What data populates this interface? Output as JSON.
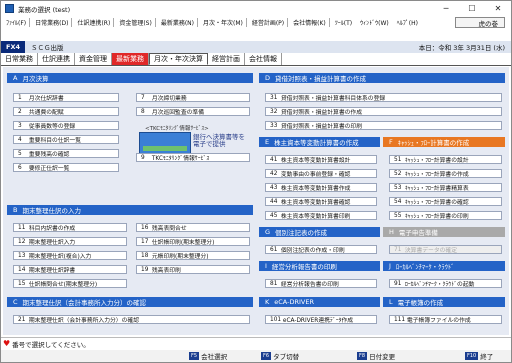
{
  "window": {
    "title": "業務の選択 (test)",
    "minimize": "─",
    "maximize": "☐",
    "close": "✕"
  },
  "menu": {
    "items": [
      "ﾌｧｲﾙ(F)",
      "日常業務(D)",
      "仕訳連携(R)",
      "資金管理(S)",
      "最新業務(N)",
      "月次・年次(M)",
      "経営計画(P)",
      "会社情報(K)",
      "ﾂｰﾙ(T)",
      "ｳｨﾝﾄﾞｳ(W)",
      "ﾍﾙﾌﾟ(H)"
    ],
    "right_label": "虎の巻"
  },
  "company": {
    "code": "FX4",
    "name": "ＳＣＧ出版",
    "date": "本日：令和 3年 3月31日 (水)"
  },
  "tabs": [
    "日常業務",
    "仕訳連携",
    "資金管理",
    "最新業務",
    "月次・年次決算",
    "経営計画",
    "会社情報"
  ],
  "sections": {
    "a": {
      "mark": "A",
      "title": "月次決算"
    },
    "b": {
      "mark": "B",
      "title": "期末整理仕訳の入力"
    },
    "c": {
      "mark": "C",
      "title": "期末整理仕訳（会計事務所入力分）の確認"
    },
    "d": {
      "mark": "D",
      "title": "貸借対照表・損益計算書の作成"
    },
    "e": {
      "mark": "E",
      "title": "株主資本等変動計算書の作成"
    },
    "f": {
      "mark": "F",
      "title": "ｷｬｯｼｭ・ﾌﾛｰ計算書の作成"
    },
    "g": {
      "mark": "G",
      "title": "個別注記表の作成"
    },
    "h": {
      "mark": "H",
      "title": "電子申告準備"
    },
    "i": {
      "mark": "I",
      "title": "経営分析報告書の印刷"
    },
    "j": {
      "mark": "J",
      "title": "ﾛｰｶﾙﾍﾞﾝﾁﾏｰｸ・ｸﾗｳﾄﾞ"
    },
    "k": {
      "mark": "K",
      "title": "eCA-DRIVER"
    },
    "l": {
      "mark": "L",
      "title": "電子帳簿の作成"
    }
  },
  "buttons": {
    "a1": {
      "num": "1",
      "label": "月次仕訳辞書"
    },
    "a2": {
      "num": "2",
      "label": "共通費の配賦"
    },
    "a3": {
      "num": "3",
      "label": "従事員数等の登録"
    },
    "a4": {
      "num": "4",
      "label": "重要科目の仕訳一覧"
    },
    "a5": {
      "num": "5",
      "label": "重要残高の確認"
    },
    "a6": {
      "num": "6",
      "label": "要修正仕訳一覧"
    },
    "a7": {
      "num": "7",
      "label": "月次締切業務"
    },
    "a8": {
      "num": "8",
      "label": "月次巡回監査の準備"
    },
    "a9": {
      "num": "9",
      "label": "TKCﾓﾆﾀﾘﾝｸﾞ情報ｻｰﾋﾞｽ"
    },
    "b11": {
      "num": "11",
      "label": "科目内訳書の作成"
    },
    "b12": {
      "num": "12",
      "label": "期末整理仕訳入力"
    },
    "b13": {
      "num": "13",
      "label": "期末整理仕訳(複合)入力"
    },
    "b14": {
      "num": "14",
      "label": "期末整理仕訳辞書"
    },
    "b15": {
      "num": "15",
      "label": "仕訳帳問合せ(期末整理分)"
    },
    "b16": {
      "num": "16",
      "label": "残高表問合せ"
    },
    "b17": {
      "num": "17",
      "label": "仕訳帳印刷(期末整理分)"
    },
    "b18": {
      "num": "18",
      "label": "元帳印刷(期末整理分)"
    },
    "b19": {
      "num": "19",
      "label": "残高表印刷"
    },
    "c21": {
      "num": "21",
      "label": "期末整理仕訳（会計事務所入力分）の確認"
    },
    "d31": {
      "num": "31",
      "label": "貸借対照表・損益計算書科目体系の登録"
    },
    "d32": {
      "num": "32",
      "label": "貸借対照表・損益計算書の作成"
    },
    "d33": {
      "num": "33",
      "label": "貸借対照表・損益計算書の印刷"
    },
    "e41": {
      "num": "41",
      "label": "株主資本等変動計算書設計"
    },
    "e42": {
      "num": "42",
      "label": "変動事由の事前登録・確認"
    },
    "e43": {
      "num": "43",
      "label": "株主資本等変動計算書作成"
    },
    "e44": {
      "num": "44",
      "label": "株主資本等変動計算書確認"
    },
    "e45": {
      "num": "45",
      "label": "株主資本等変動計算書印刷"
    },
    "f51": {
      "num": "51",
      "label": "ｷｬｯｼｭ・ﾌﾛｰ計算書の設計"
    },
    "f52": {
      "num": "52",
      "label": "ｷｬｯｼｭ・ﾌﾛｰ計算書の作成"
    },
    "f53": {
      "num": "53",
      "label": "ｷｬｯｼｭ・ﾌﾛｰ計算書精算表"
    },
    "f54": {
      "num": "54",
      "label": "ｷｬｯｼｭ・ﾌﾛｰ計算書の確認"
    },
    "f55": {
      "num": "55",
      "label": "ｷｬｯｼｭ・ﾌﾛｰ計算書の印刷"
    },
    "g61": {
      "num": "61",
      "label": "個別注記表の作成・印刷"
    },
    "h71": {
      "num": "71",
      "label": "決算書データの確定"
    },
    "i81": {
      "num": "81",
      "label": "経営分析報告書の印刷"
    },
    "j91": {
      "num": "91",
      "label": "ﾛｰｶﾙﾍﾞﾝﾁﾏｰｸ・ｸﾗｳﾄﾞの起動"
    },
    "k101": {
      "num": "101",
      "label": "eCA-DRIVER連携ﾃﾞｰﾀ作成"
    },
    "l111": {
      "num": "111",
      "label": "電子帳簿ファイルの作成"
    }
  },
  "promo": {
    "title": "<TKCﾓﾆﾀﾘﾝｸﾞ情報ｻｰﾋﾞｽ>",
    "text": "銀行へ決算書等を電子で提供"
  },
  "status": {
    "text": "番号で選択してください。"
  },
  "fkeys": [
    {
      "key": "F5",
      "label": "会社選択"
    },
    {
      "key": "F6",
      "label": "タブ切替"
    },
    {
      "key": "F8",
      "label": "日付変更"
    },
    {
      "key": "F10",
      "label": "終了"
    }
  ]
}
